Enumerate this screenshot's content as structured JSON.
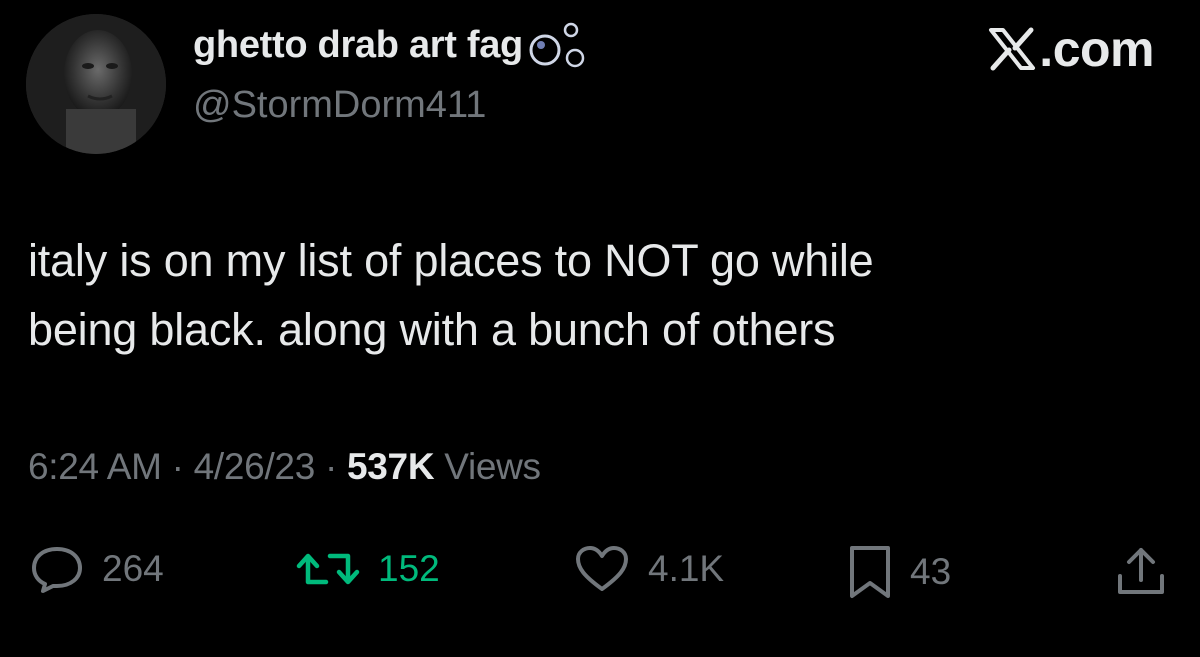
{
  "author": {
    "display_name": "ghetto drab art fag",
    "handle": "@StormDorm411",
    "avatar_icon": "profile-photo",
    "name_decoration_icon": "bubbles-icon"
  },
  "brand": {
    "logo_icon": "x-logo-icon",
    "text": ".com"
  },
  "tweet": {
    "line1": "italy is on my list of places to NOT go while",
    "line2": "being black. along with a bunch of others"
  },
  "meta": {
    "time": "6:24 AM",
    "sep1": " · ",
    "date": "4/26/23",
    "sep2": " · ",
    "views_count": "537K",
    "views_label": " Views"
  },
  "actions": {
    "replies": {
      "icon": "reply-icon",
      "count": "264"
    },
    "retweets": {
      "icon": "retweet-icon",
      "count": "152",
      "active": true,
      "color": "#00ba7c"
    },
    "likes": {
      "icon": "heart-icon",
      "count": "4.1K"
    },
    "bookmarks": {
      "icon": "bookmark-icon",
      "count": "43"
    },
    "share": {
      "icon": "share-icon"
    }
  },
  "colors": {
    "background": "#000000",
    "text": "#e7e9ea",
    "muted": "#71767b"
  }
}
